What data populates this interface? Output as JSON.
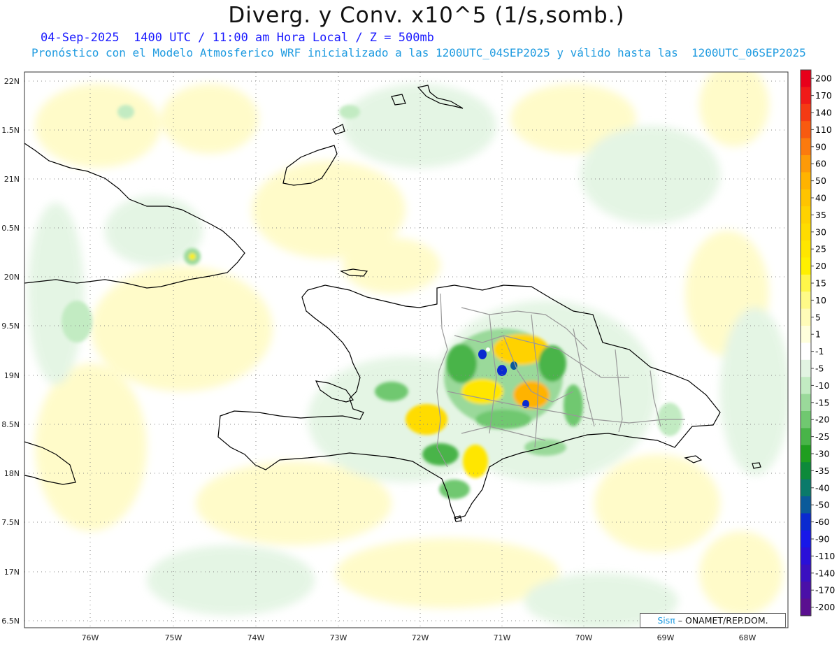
{
  "title": "Diverg. y Conv. x10^5 (1/s,somb.)",
  "subtitle_time": "04-Sep-2025  1400 UTC / 11:00 am Hora Local / Z = 500mb",
  "subtitle_model": "Pronóstico con el Modelo Atmosferico WRF inicializado a las 1200UTC_04SEP2025 y válido hasta las  1200UTC_06SEP2025",
  "map": {
    "lat_labels": [
      "22N",
      "1.5N",
      "21N",
      "0.5N",
      "20N",
      "9.5N",
      "19N",
      "8.5N",
      "18N",
      "7.5N",
      "17N",
      "6.5N"
    ],
    "lon_labels": [
      "76W",
      "75W",
      "74W",
      "73W",
      "72W",
      "71W",
      "70W",
      "69W",
      "68W"
    ],
    "grid_style": "dotted",
    "colors": {
      "coast": "#000000",
      "provinces": "#999999",
      "grid": "#888888"
    }
  },
  "colorbar": {
    "labels": [
      "200",
      "170",
      "140",
      "110",
      "90",
      "60",
      "50",
      "40",
      "35",
      "30",
      "25",
      "20",
      "15",
      "10",
      "5",
      "1",
      "-1",
      "-5",
      "-10",
      "-15",
      "-20",
      "-25",
      "-30",
      "-35",
      "-40",
      "-50",
      "-60",
      "-90",
      "-110",
      "-140",
      "-170",
      "-200"
    ],
    "colors": [
      "#e8001a",
      "#f01a18",
      "#f53a14",
      "#f85a10",
      "#fb7a0e",
      "#fd9a08",
      "#ffb300",
      "#ffc400",
      "#ffd200",
      "#ffdc00",
      "#ffe600",
      "#fff000",
      "#fff64a",
      "#fffa88",
      "#fffcb8",
      "#ffffdc",
      "#ffffff",
      "#e2f4e2",
      "#c2ebc2",
      "#9ad99a",
      "#70c870",
      "#48b448",
      "#1f9e1f",
      "#0d8a3a",
      "#0a7a6a",
      "#0a5a9a",
      "#0a2ad0",
      "#1818e8",
      "#2a10d8",
      "#3a10c0",
      "#4a10a8",
      "#5a0f90"
    ]
  },
  "credit": {
    "sis": "Sisπ",
    "rest": " – ONAMET/REP.DOM."
  }
}
